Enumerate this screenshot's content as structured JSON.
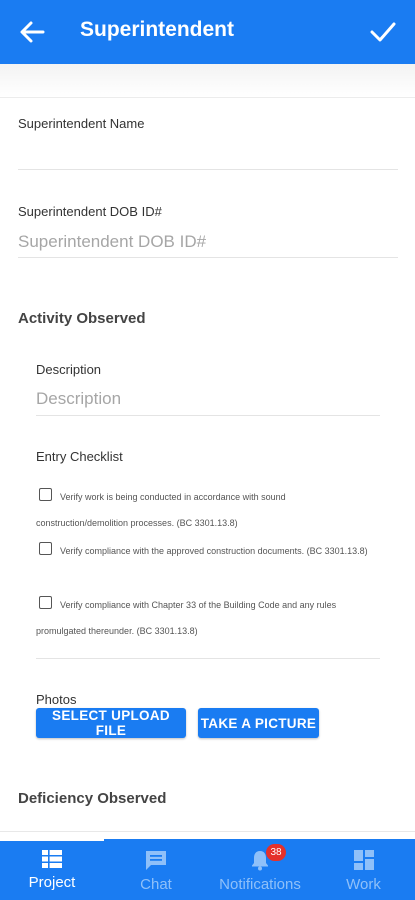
{
  "appbar": {
    "title": "Superintendent"
  },
  "superintendent_name": {
    "label": "Superintendent Name",
    "value": "",
    "placeholder": ""
  },
  "superintendent_dob": {
    "label": "Superintendent DOB ID#",
    "value": "",
    "placeholder": "Superintendent DOB ID#"
  },
  "activity_observed": {
    "title": "Activity Observed",
    "description_label": "Description",
    "description_placeholder": "Description",
    "checklist_title": "Entry Checklist",
    "checklist": [
      {
        "text": "Verify work is being conducted in accordance with sound construction/demolition processes. (BC 3301.13.8)",
        "checked": false
      },
      {
        "text": "Verify compliance with the approved construction documents. (BC 3301.13.8)",
        "checked": false
      },
      {
        "text": "Verify compliance with Chapter 33 of the Building Code and any rules promulgated thereunder. (BC 3301.13.8)",
        "checked": false
      }
    ],
    "photos_label": "Photos",
    "upload_button": "SELECT UPLOAD FILE",
    "picture_button": "TAKE A PICTURE"
  },
  "deficiency_observed": {
    "title": "Deficiency Observed"
  },
  "bottom_nav": {
    "items": [
      {
        "label": "Project",
        "icon": "list-icon",
        "active": true
      },
      {
        "label": "Chat",
        "icon": "chat-icon",
        "active": false
      },
      {
        "label": "Notifications",
        "icon": "bell-icon",
        "active": false,
        "badge": "38"
      },
      {
        "label": "Work",
        "icon": "grid-icon",
        "active": false
      }
    ]
  },
  "colors": {
    "primary": "#1a7cf2",
    "inactive_nav_text": "#8fc0f9",
    "badge": "#e5312b"
  }
}
